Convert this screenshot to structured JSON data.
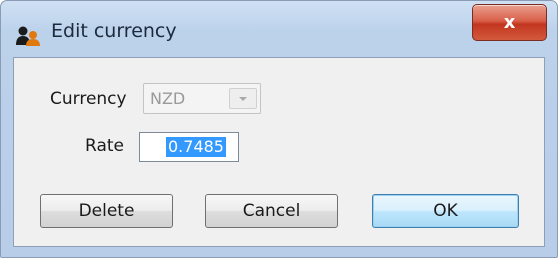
{
  "window": {
    "title": "Edit currency",
    "title_icon": "users-icon",
    "close_label": "x"
  },
  "form": {
    "currency_label": "Currency",
    "currency_value": "NZD",
    "currency_enabled": false,
    "rate_label": "Rate",
    "rate_value": "0.7485"
  },
  "buttons": {
    "delete_label": "Delete",
    "cancel_label": "Cancel",
    "ok_label": "OK"
  }
}
